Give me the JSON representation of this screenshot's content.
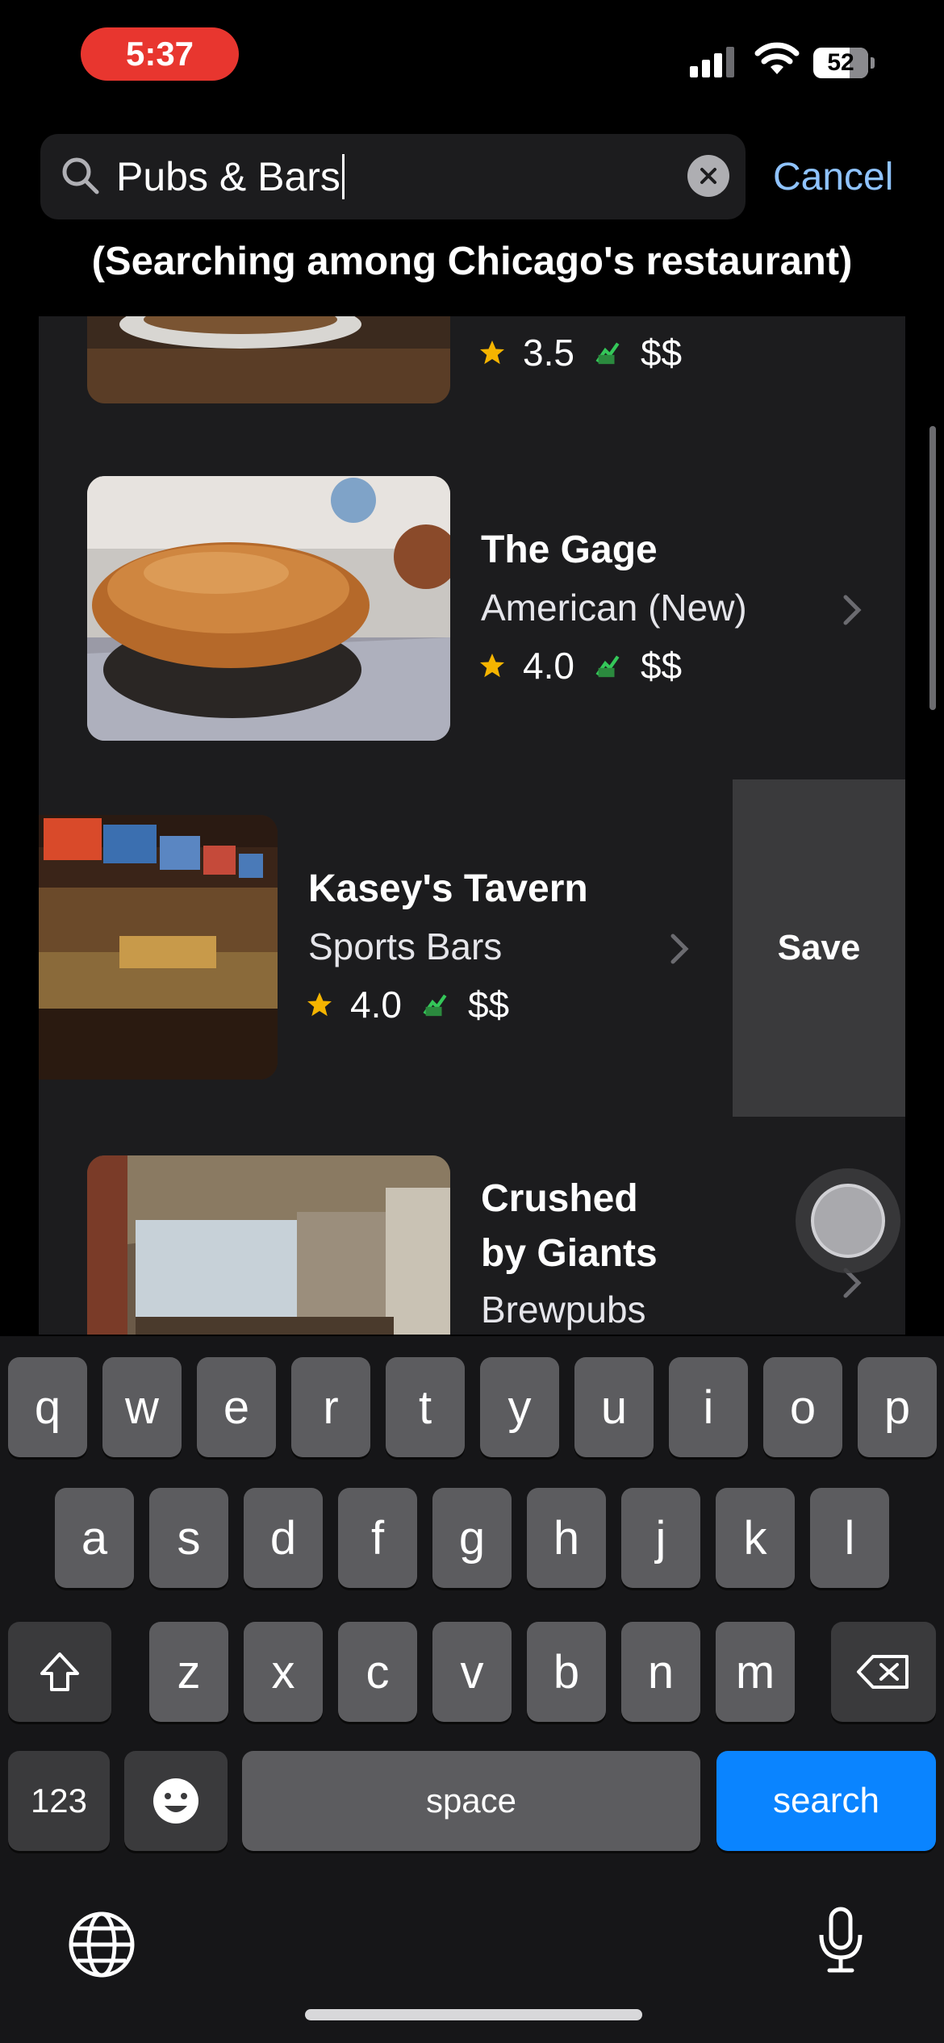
{
  "status_bar": {
    "time": "5:37",
    "battery": "52"
  },
  "search": {
    "query": "Pubs & Bars",
    "cancel_label": "Cancel"
  },
  "subtitle": "(Searching among Chicago's restaurant)",
  "results": [
    {
      "name": "",
      "category": "",
      "rating": "3.5",
      "price": "$$"
    },
    {
      "name": "The Gage",
      "category": "American (New)",
      "rating": "4.0",
      "price": "$$"
    },
    {
      "name": "Kasey's Tavern",
      "category": "Sports Bars",
      "rating": "4.0",
      "price": "$$"
    },
    {
      "name_line1": "Crushed",
      "name_line2": "by Giants",
      "category": "Brewpubs"
    }
  ],
  "swipe_action": {
    "label": "Save"
  },
  "keyboard": {
    "row1": [
      "q",
      "w",
      "e",
      "r",
      "t",
      "y",
      "u",
      "i",
      "o",
      "p"
    ],
    "row2": [
      "a",
      "s",
      "d",
      "f",
      "g",
      "h",
      "j",
      "k",
      "l"
    ],
    "row3": [
      "z",
      "x",
      "c",
      "v",
      "b",
      "n",
      "m"
    ],
    "numbers_label": "123",
    "space_label": "space",
    "search_label": "search"
  },
  "colors": {
    "accent": "#0a84ff",
    "cancel": "#8fc3ff",
    "time_pill": "#e8362f",
    "star": "#f5b400"
  },
  "icons": [
    "search-icon",
    "clear-icon",
    "star-icon",
    "price-icon",
    "chevron-right-icon",
    "shift-icon",
    "delete-icon",
    "emoji-icon",
    "globe-icon",
    "microphone-icon"
  ]
}
